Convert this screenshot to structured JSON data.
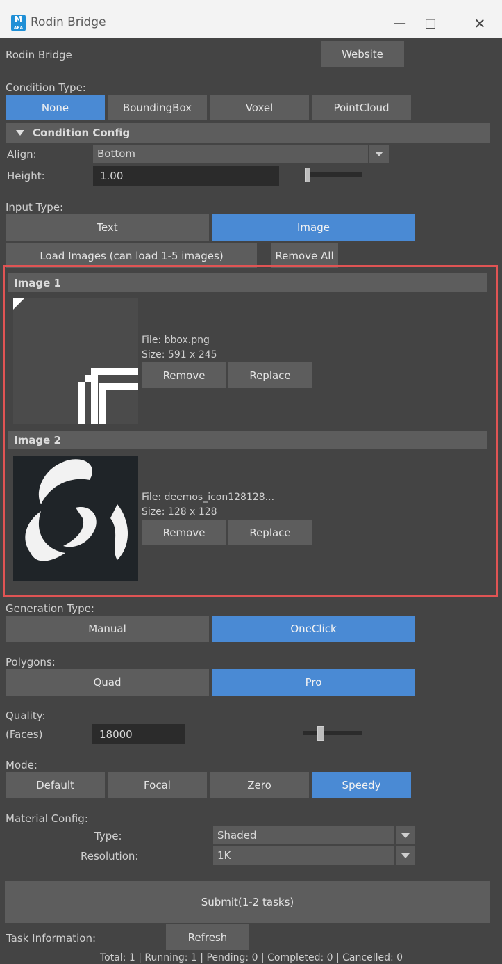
{
  "window": {
    "title": "Rodin Bridge",
    "icon_letter": "M",
    "icon_sub": "AEA"
  },
  "header": {
    "label": "Rodin Bridge",
    "website_button": "Website"
  },
  "condition_type": {
    "label": "Condition Type:",
    "options": [
      "None",
      "BoundingBox",
      "Voxel",
      "PointCloud"
    ],
    "selected": "None"
  },
  "condition_config": {
    "title": "Condition Config",
    "align_label": "Align:",
    "align_value": "Bottom",
    "height_label": "Height:",
    "height_value": "1.00"
  },
  "input_type": {
    "label": "Input Type:",
    "options": [
      "Text",
      "Image"
    ],
    "selected": "Image",
    "load_button": "Load Images (can load 1-5 images)",
    "remove_all_button": "Remove All"
  },
  "images": [
    {
      "title": "Image 1",
      "file": "File: bbox.png",
      "size": "Size: 591 x 245",
      "remove": "Remove",
      "replace": "Replace"
    },
    {
      "title": "Image 2",
      "file": "File: deemos_icon128128...",
      "size": "Size: 128 x 128",
      "remove": "Remove",
      "replace": "Replace"
    }
  ],
  "generation_type": {
    "label": "Generation Type:",
    "options": [
      "Manual",
      "OneClick"
    ],
    "selected": "OneClick"
  },
  "polygons": {
    "label": "Polygons:",
    "options": [
      "Quad",
      "Pro"
    ],
    "selected": "Pro"
  },
  "quality": {
    "label": "Quality:",
    "sub_label": "(Faces)",
    "value": "18000"
  },
  "mode": {
    "label": "Mode:",
    "options": [
      "Default",
      "Focal",
      "Zero",
      "Speedy"
    ],
    "selected": "Speedy"
  },
  "material_config": {
    "label": "Material Config:",
    "type_label": "Type:",
    "type_value": "Shaded",
    "resolution_label": "Resolution:",
    "resolution_value": "1K"
  },
  "submit_button": "Submit(1-2 tasks)",
  "task_info": {
    "label": "Task Information:",
    "refresh_button": "Refresh",
    "status": "Total: 1 | Running: 1 | Pending: 0 | Completed: 0 | Cancelled: 0"
  },
  "colors": {
    "accent": "#4a8ad4",
    "highlight_border": "#e05454",
    "background": "#444444"
  }
}
